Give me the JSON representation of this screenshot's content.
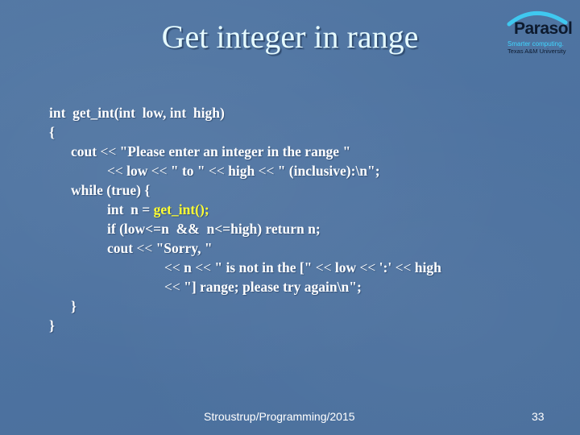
{
  "slide": {
    "title": "Get integer in range",
    "logo": {
      "name": "Parasol",
      "tagline": "Smarter computing.",
      "institution": "Texas A&M University",
      "arc_color": "#3fc8f0"
    },
    "code_lines": [
      {
        "indent": 0,
        "parts": [
          {
            "text": "int  get_int(int  low, int  high)"
          }
        ]
      },
      {
        "indent": 0,
        "parts": [
          {
            "text": "{"
          }
        ]
      },
      {
        "indent": 1,
        "parts": [
          {
            "text": "cout "
          },
          {
            "text": "<<",
            "op": true
          },
          {
            "text": " \"Please enter an integer in the range \""
          }
        ]
      },
      {
        "indent": 2,
        "parts": [
          {
            "text": "<<",
            "op": true
          },
          {
            "text": " low "
          },
          {
            "text": "<<",
            "op": true
          },
          {
            "text": " \" to \" "
          },
          {
            "text": "<<",
            "op": true
          },
          {
            "text": " high "
          },
          {
            "text": "<<",
            "op": true
          },
          {
            "text": " \" (inclusive):\\n\";"
          }
        ]
      },
      {
        "indent": 1,
        "parts": [
          {
            "text": "while (true) {"
          }
        ]
      },
      {
        "indent": 2,
        "parts": [
          {
            "text": "int  n = "
          },
          {
            "text": "get_int();",
            "highlight": true
          }
        ]
      },
      {
        "indent": 2,
        "parts": [
          {
            "text": "if (low<=n  &&  n<=high) return n;"
          }
        ]
      },
      {
        "indent": 2,
        "parts": [
          {
            "text": "cout "
          },
          {
            "text": "<<",
            "op": true
          },
          {
            "text": " \"Sorry, \""
          }
        ]
      },
      {
        "indent": 3,
        "parts": [
          {
            "text": "<<",
            "op": true
          },
          {
            "text": " n "
          },
          {
            "text": "<<",
            "op": true
          },
          {
            "text": " \" is not in the [\" "
          },
          {
            "text": "<<",
            "op": true
          },
          {
            "text": " low "
          },
          {
            "text": "<<",
            "op": true
          },
          {
            "text": " ':' "
          },
          {
            "text": "<<",
            "op": true
          },
          {
            "text": " high"
          }
        ]
      },
      {
        "indent": 3,
        "parts": [
          {
            "text": "<<",
            "op": true
          },
          {
            "text": " \"] range; please try again\\n\";"
          }
        ]
      },
      {
        "indent": 1,
        "parts": [
          {
            "text": "}"
          }
        ]
      },
      {
        "indent": 0,
        "parts": [
          {
            "text": "}"
          }
        ]
      }
    ],
    "footer": "Stroustrup/Programming/2015",
    "page_number": "33",
    "colors": {
      "background": "#4f74a0",
      "title": "#e6fbff",
      "code": "#ffffff",
      "highlight": "#ffff33"
    }
  }
}
